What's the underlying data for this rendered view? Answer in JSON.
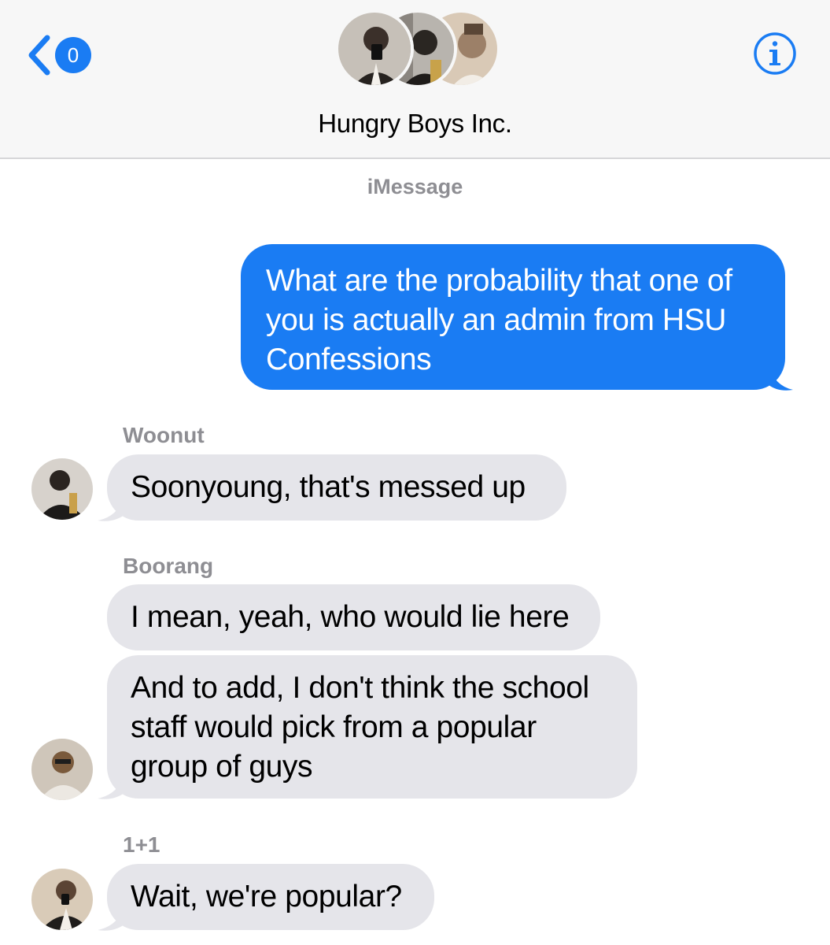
{
  "header": {
    "back": {
      "unread_count": "0"
    },
    "conversation_title": "Hungry Boys Inc.",
    "info_icon": "info-icon"
  },
  "thread": {
    "service_label": "iMessage",
    "messages": [
      {
        "direction": "outgoing",
        "text": "What are the probability that one of you is actually an admin from HSU Confessions"
      },
      {
        "direction": "incoming",
        "sender": "Woonut",
        "text": "Soonyoung, that's messed up"
      },
      {
        "direction": "incoming",
        "sender": "Boorang",
        "text": "I mean, yeah, who would lie here"
      },
      {
        "direction": "incoming",
        "sender": "Boorang",
        "text": "And to add, I don't think the school staff would pick from a popular group of guys"
      },
      {
        "direction": "incoming",
        "sender": "1+1",
        "text": "Wait, we're popular?"
      }
    ]
  },
  "colors": {
    "accent": "#1a7cf3",
    "incoming_bubble": "#e5e5ea",
    "header_bg": "#f7f7f7",
    "secondary_text": "#8e8e93"
  }
}
